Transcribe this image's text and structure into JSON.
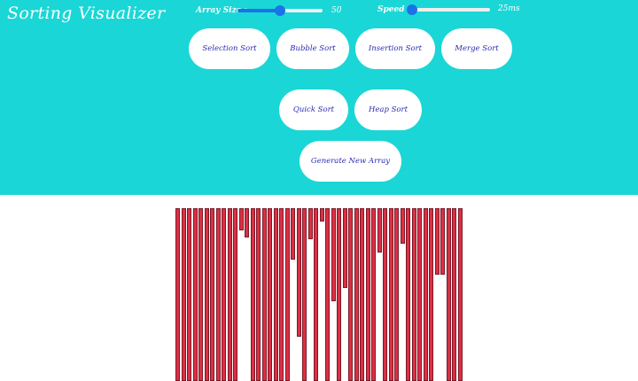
{
  "app": {
    "title": "Sorting Visualizer"
  },
  "controls": {
    "array_size": {
      "label": "Array Size :",
      "value": "50",
      "fraction": 0.5
    },
    "speed": {
      "label": "Speed :",
      "value": "25ms",
      "fraction": 0.0
    }
  },
  "buttons": {
    "selection_sort": "Selection Sort",
    "bubble_sort": "Bubble Sort",
    "insertion_sort": "Insertion Sort",
    "merge_sort": "Merge Sort",
    "quick_sort": "Quick Sort",
    "heap_sort": "Heap Sort",
    "generate_new_array": "Generate New Array"
  },
  "colors": {
    "header_bg": "#1bd6d6",
    "bar_color": "#dc2f45",
    "button_text": "#2b2bb3",
    "slider_accent": "#1a73e8"
  },
  "array_values": [
    195,
    195,
    195,
    195,
    195,
    195,
    195,
    195,
    195,
    195,
    195,
    25,
    33,
    195,
    195,
    195,
    195,
    195,
    195,
    195,
    58,
    145,
    195,
    35,
    195,
    15,
    195,
    105,
    195,
    90,
    195,
    195,
    195,
    195,
    195,
    50,
    195,
    195,
    195,
    40,
    195,
    195,
    195,
    195,
    195,
    75,
    75,
    195,
    195,
    195
  ]
}
